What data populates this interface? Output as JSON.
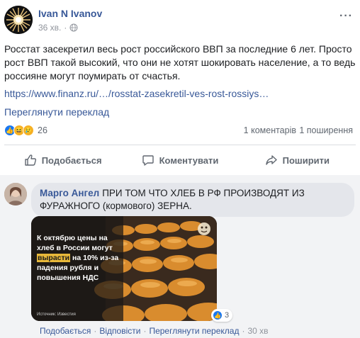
{
  "post": {
    "author": "Ivan N Ivanov",
    "time": "36 хв.",
    "text": "Росстат засекретил весь рост российского ВВП за последние 6 лет. Просто рост ВВП такой высокий, что они не хотят шокировать население, а то ведь россияне могут поумирать от счастья.",
    "link": "https://www.finanz.ru/…/rosstat-zasekretil-ves-rost-rossiys…",
    "translate": "Переглянути переклад",
    "reactions_count": "26",
    "comments_count": "1 коментарів",
    "shares_count": "1 поширення"
  },
  "actions": {
    "like": "Подобається",
    "comment": "Коментувати",
    "share": "Поширити"
  },
  "comment": {
    "author": "Марго Ангел",
    "text": "ПРИ ТОМ ЧТО ХЛЕБ В РФ ПРОИЗВОДЯТ ИЗ ФУРАЖНОГО (кормового) ЗЕРНА.",
    "image": {
      "line1": "К октябрю цены на хлеб в России могут ",
      "highlight": "вырасти",
      "line2": " на 10% из-за падения рубля и повышения НДС",
      "source": "Источник: Известия"
    },
    "likes": "3",
    "actions": {
      "like": "Подобається",
      "reply": "Відповісти",
      "translate": "Переглянути переклад",
      "time": "30 хв"
    }
  },
  "colors": {
    "link": "#385898",
    "like_blue": "#1877f2",
    "bg_comment": "#f2f3f5"
  }
}
